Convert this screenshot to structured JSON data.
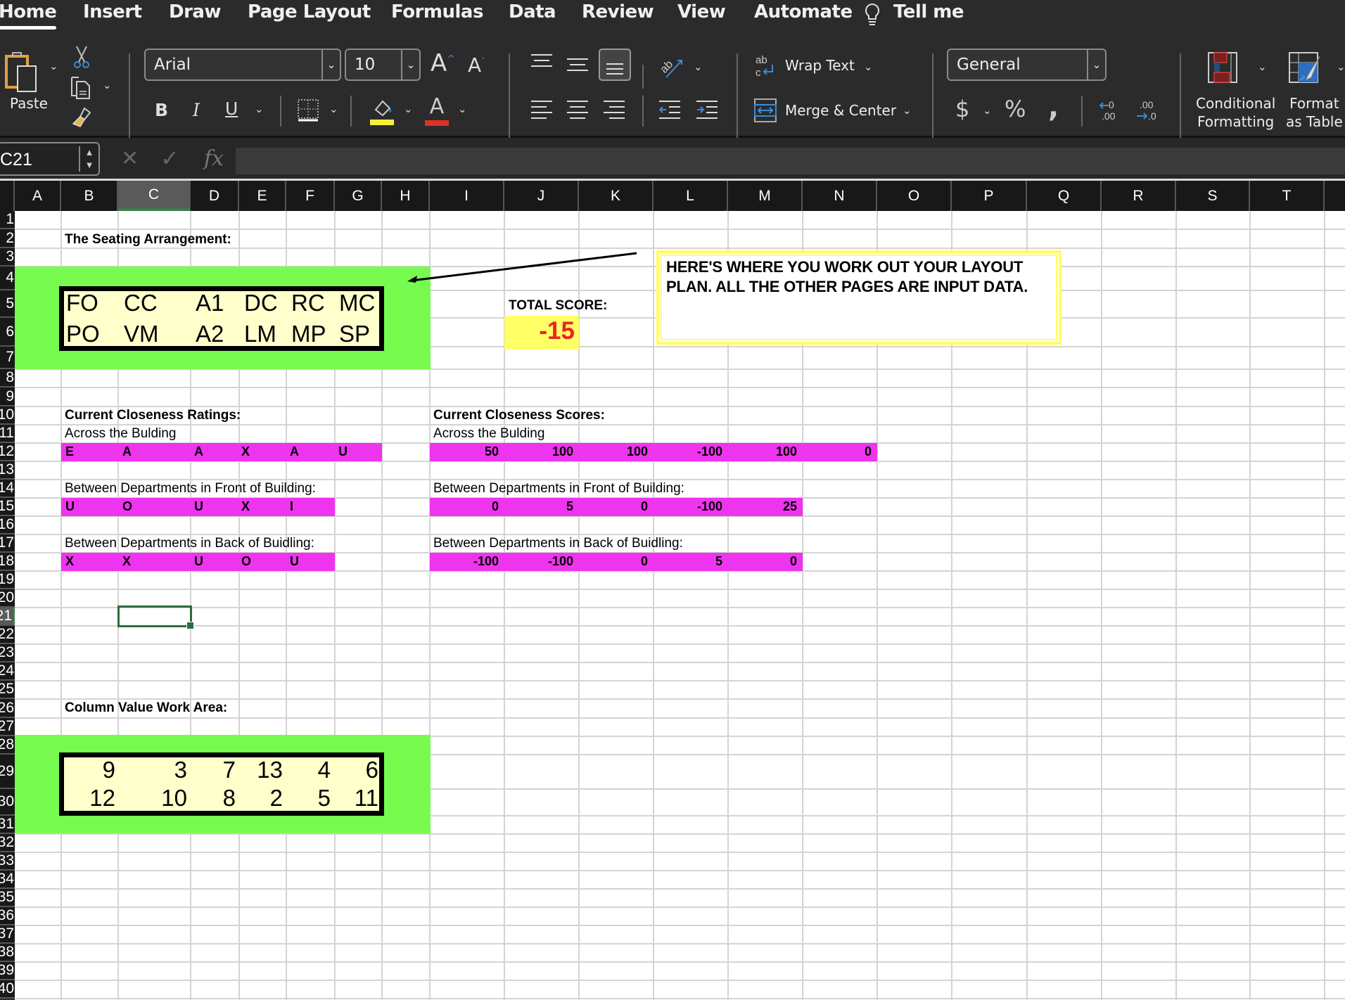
{
  "tabs": [
    "Home",
    "Insert",
    "Draw",
    "Page Layout",
    "Formulas",
    "Data",
    "Review",
    "View",
    "Automate",
    "Tell me"
  ],
  "active_tab": "Home",
  "ribbon": {
    "paste_label": "Paste",
    "font_name": "Arial",
    "font_size": "10",
    "bold": "B",
    "italic": "I",
    "underline": "U",
    "font_color_glyph": "A",
    "wrap_text": "Wrap Text",
    "merge_center": "Merge & Center",
    "number_format": "General",
    "currency": "$",
    "percent": "%",
    "comma": "'",
    "conditional_formatting_line1": "Conditional",
    "conditional_formatting_line2": "Formatting",
    "format_table_line1": "Format",
    "format_table_line2": "as Table",
    "colors": {
      "highlight": "#f5f03a",
      "font_color": "#e03127"
    }
  },
  "formula_bar": {
    "name_box": "C21",
    "fx_label": "fx",
    "formula": ""
  },
  "columns": [
    "A",
    "B",
    "C",
    "D",
    "E",
    "F",
    "G",
    "H",
    "I",
    "J",
    "K",
    "L",
    "M",
    "N",
    "O",
    "P",
    "Q",
    "R",
    "S",
    "T"
  ],
  "selected_column": "C",
  "selected_row": "21",
  "rows": [
    "1",
    "2",
    "3",
    "4",
    "5",
    "6",
    "7",
    "8",
    "9",
    "10",
    "11",
    "12",
    "13",
    "14",
    "15",
    "16",
    "17",
    "18",
    "19",
    "20",
    "21",
    "22",
    "23",
    "24",
    "25",
    "26",
    "27",
    "28",
    "29",
    "30",
    "31",
    "32",
    "33",
    "34",
    "35",
    "36",
    "37",
    "38",
    "39",
    "40"
  ],
  "sheet": {
    "seating_title": "The Seating Arrangement:",
    "seating": [
      [
        "FO",
        "CC",
        "A1",
        "DC",
        "RC",
        "MC"
      ],
      [
        "PO",
        "VM",
        "A2",
        "LM",
        "MP",
        "SP"
      ]
    ],
    "total_score_label": "TOTAL SCORE:",
    "total_score": "-15",
    "note": "HERE'S WHERE YOU WORK OUT YOUR LAYOUT PLAN.  ALL THE OTHER PAGES ARE INPUT DATA.",
    "ratings_title": "Current Closeness Ratings:",
    "scores_title": "Current Closeness Scores:",
    "across_label": "Across the Bulding",
    "front_label": "Between Departments in Front of Building:",
    "back_label": "Between Departments in Back of Buidling:",
    "ratings": {
      "across": [
        "E",
        "A",
        "A",
        "X",
        "A",
        "U"
      ],
      "front": [
        "U",
        "O",
        "U",
        "X",
        "I"
      ],
      "back": [
        "X",
        "X",
        "U",
        "O",
        "U"
      ]
    },
    "scores": {
      "across": [
        "50",
        "100",
        "100",
        "-100",
        "100",
        "0"
      ],
      "front": [
        "0",
        "5",
        "0",
        "-100",
        "25"
      ],
      "back": [
        "-100",
        "-100",
        "0",
        "5",
        "0"
      ]
    },
    "column_value_title": "Column Value Work Area:",
    "column_values": [
      [
        "9",
        "3",
        "7",
        "13",
        "4",
        "6"
      ],
      [
        "12",
        "10",
        "8",
        "2",
        "5",
        "11"
      ]
    ],
    "colors": {
      "green": "#77fb4f",
      "magenta": "#ee34ee",
      "seat_fill": "#ffffcc",
      "score_fill": "#ffff66",
      "score_text": "#ee2222"
    }
  }
}
